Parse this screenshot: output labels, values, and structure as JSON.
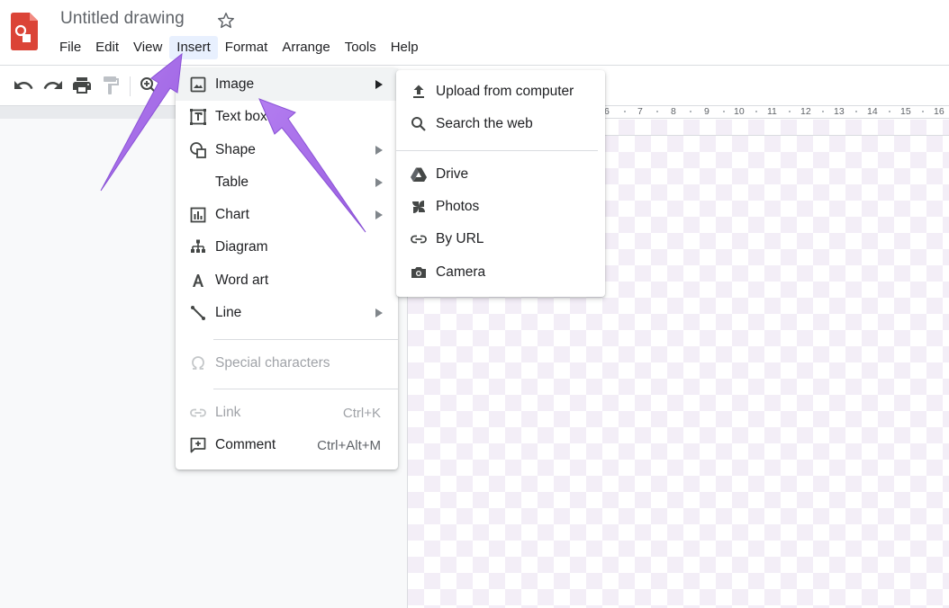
{
  "header": {
    "title": "Untitled drawing",
    "menu": [
      "File",
      "Edit",
      "View",
      "Insert",
      "Format",
      "Arrange",
      "Tools",
      "Help"
    ],
    "active_menu": "Insert"
  },
  "ruler": {
    "ticks": [
      "6",
      "7",
      "8",
      "9",
      "10",
      "11",
      "12",
      "13",
      "14",
      "15",
      "16"
    ]
  },
  "insert_menu": {
    "items": [
      {
        "label": "Image",
        "icon": "image-icon",
        "submenu": true,
        "highlighted": true
      },
      {
        "label": "Text box",
        "icon": "text-box-icon"
      },
      {
        "label": "Shape",
        "icon": "shape-icon",
        "submenu": true
      },
      {
        "label": "Table",
        "icon": "",
        "submenu": true
      },
      {
        "label": "Chart",
        "icon": "chart-icon",
        "submenu": true
      },
      {
        "label": "Diagram",
        "icon": "diagram-icon"
      },
      {
        "label": "Word art",
        "icon": "word-art-icon"
      },
      {
        "label": "Line",
        "icon": "line-icon",
        "submenu": true
      },
      {
        "label": "Special characters",
        "icon": "omega-icon",
        "disabled": true
      },
      {
        "label": "Link",
        "icon": "link-icon",
        "shortcut": "Ctrl+K",
        "disabled": true
      },
      {
        "label": "Comment",
        "icon": "comment-icon",
        "shortcut": "Ctrl+Alt+M"
      }
    ]
  },
  "image_submenu": {
    "items": [
      {
        "label": "Upload from computer",
        "icon": "upload-icon"
      },
      {
        "label": "Search the web",
        "icon": "search-icon"
      },
      {
        "label": "Drive",
        "icon": "drive-icon"
      },
      {
        "label": "Photos",
        "icon": "photos-pinwheel-icon"
      },
      {
        "label": "By URL",
        "icon": "link-icon"
      },
      {
        "label": "Camera",
        "icon": "camera-icon"
      }
    ]
  },
  "colors": {
    "app_red": "#db4437",
    "annotation_arrow": "#a66ee8",
    "menu_highlight": "#f1f3f4",
    "active_menu_bg": "#e8f0fe"
  }
}
